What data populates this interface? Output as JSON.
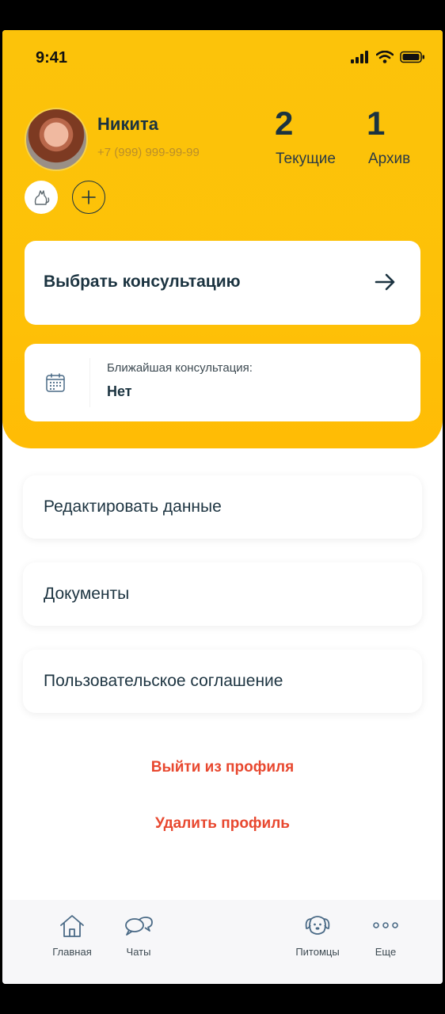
{
  "status_bar": {
    "time": "9:41"
  },
  "profile": {
    "name": "Никита",
    "phone": "+7 (999) 999-99-99"
  },
  "stats": [
    {
      "value": "2",
      "label": "Текущие"
    },
    {
      "value": "1",
      "label": "Архив"
    }
  ],
  "actions": {
    "choose_consultation": "Выбрать консультацию",
    "next_consultation_title": "Ближайшая консультация:",
    "next_consultation_value": "Нет"
  },
  "menu": [
    {
      "label": "Редактировать данные"
    },
    {
      "label": "Документы"
    },
    {
      "label": "Пользовательское соглашение"
    }
  ],
  "danger": {
    "logout": "Выйти из профиля",
    "delete": "Удалить профиль"
  },
  "tabs": [
    {
      "label": "Главная",
      "icon": "home-icon"
    },
    {
      "label": "Чаты",
      "icon": "chat-icon"
    },
    {
      "label": "Питомцы",
      "icon": "dog-icon"
    },
    {
      "label": "Еще",
      "icon": "more-icon"
    }
  ],
  "colors": {
    "accent": "#fdc108",
    "text_dark": "#1b3340",
    "danger": "#e8482f"
  }
}
